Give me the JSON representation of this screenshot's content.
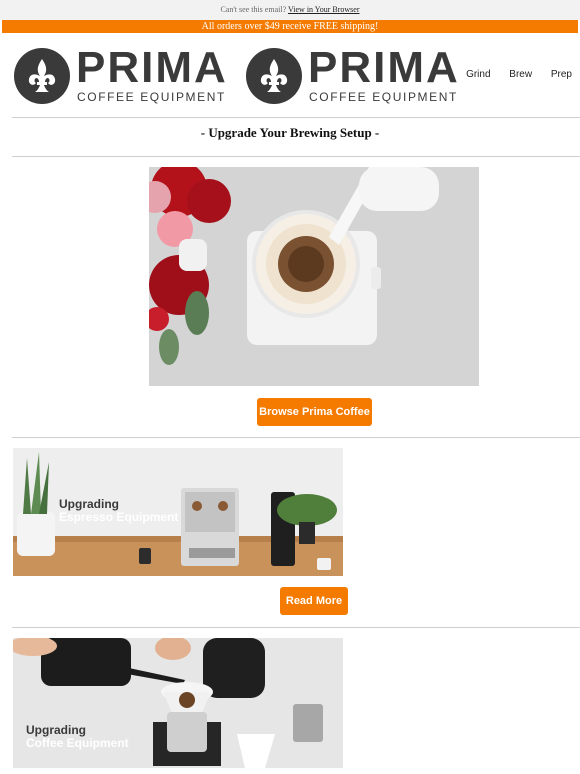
{
  "preheader": {
    "text": "Can't see this email?",
    "link": "View in Your Browser"
  },
  "shipping_bar": "All orders over $49 receive FREE shipping!",
  "logo": {
    "word": "PRIMA",
    "subtitle": "COFFEE EQUIPMENT"
  },
  "nav": [
    "Grind",
    "Brew",
    "Prep"
  ],
  "headline": "- Upgrade Your Brewing Setup -",
  "hero": {
    "button": "Browse Prima Coffee"
  },
  "espresso": {
    "overlay_line1": "Upgrading",
    "overlay_line2": "Espresso Equipment",
    "button": "Read More"
  },
  "coffee": {
    "overlay_line1": "Upgrading",
    "overlay_line2": "Coffee Equipment"
  },
  "colors": {
    "accent": "#f47b00",
    "logo": "#3a3a3a"
  }
}
